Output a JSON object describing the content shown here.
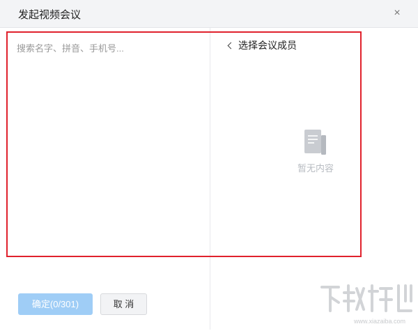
{
  "dialog": {
    "title": "发起视频会议",
    "close_label": "×"
  },
  "search": {
    "placeholder": "搜索名字、拼音、手机号..."
  },
  "members_panel": {
    "back_label": "选择会议成员",
    "empty_text": "暂无内容"
  },
  "footer": {
    "confirm_label": "确定(0/301)",
    "cancel_label": "取 消"
  },
  "colors": {
    "highlight": "#e0212c",
    "confirm_disabled": "#9fcdf6"
  },
  "watermark": {
    "text": "www.xiazaiba.com"
  }
}
